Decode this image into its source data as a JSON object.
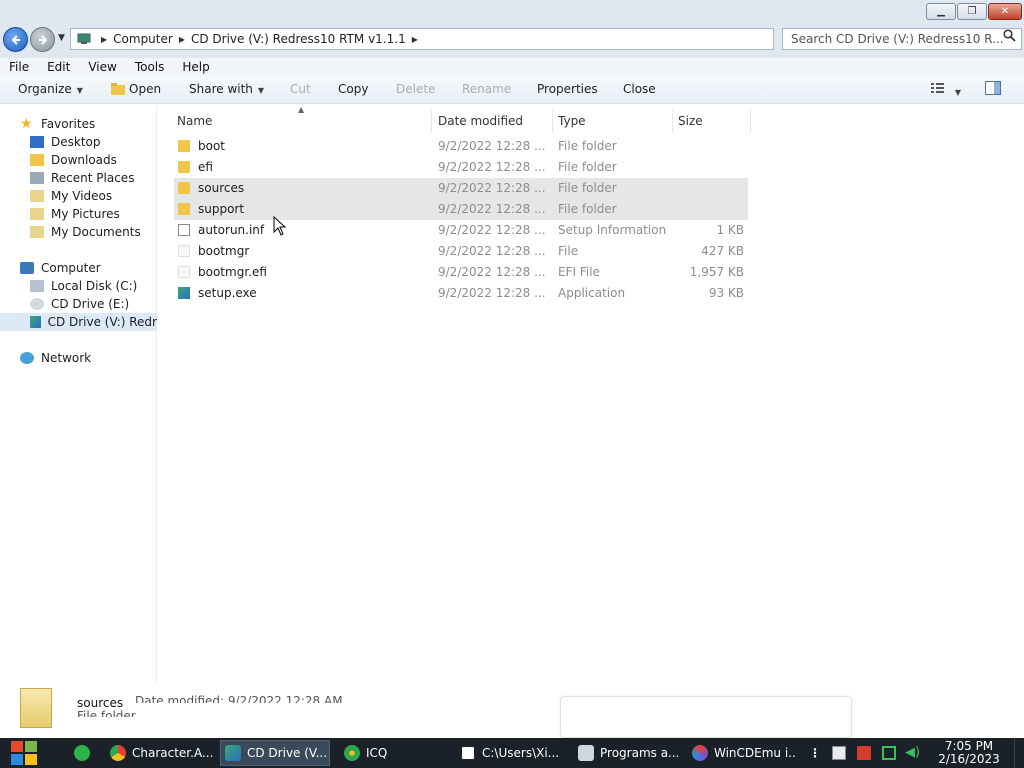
{
  "window": {
    "minimize_symbol": "▁",
    "maximize_symbol": "❐",
    "close_symbol": "✕"
  },
  "address": {
    "crumbs": [
      "Computer",
      "CD Drive (V:) Redress10 RTM v1.1.1"
    ],
    "search_placeholder": "Search CD Drive (V:) Redress10 R..."
  },
  "menu": [
    "File",
    "Edit",
    "View",
    "Tools",
    "Help"
  ],
  "commands": {
    "organize": "Organize",
    "open": "Open",
    "share_with": "Share with",
    "cut": "Cut",
    "copy": "Copy",
    "delete": "Delete",
    "rename": "Rename",
    "properties": "Properties",
    "close": "Close"
  },
  "sidebar": {
    "favorites": "Favorites",
    "favorites_items": [
      "Desktop",
      "Downloads",
      "Recent Places",
      "My Videos",
      "My Pictures",
      "My Documents"
    ],
    "computer": "Computer",
    "computer_items": [
      "Local Disk (C:)",
      "CD Drive (E:)",
      "CD Drive (V:) Redr"
    ],
    "network": "Network"
  },
  "columns": {
    "name": "Name",
    "date": "Date modified",
    "type": "Type",
    "size": "Size"
  },
  "files": [
    {
      "name": "boot",
      "date": "9/2/2022 12:28 ...",
      "type": "File folder",
      "size": "",
      "icon": "folder-icon",
      "selected": false
    },
    {
      "name": "efi",
      "date": "9/2/2022 12:28 ...",
      "type": "File folder",
      "size": "",
      "icon": "folder-icon",
      "selected": false
    },
    {
      "name": "sources",
      "date": "9/2/2022 12:28 ...",
      "type": "File folder",
      "size": "",
      "icon": "folder-icon",
      "selected": true
    },
    {
      "name": "support",
      "date": "9/2/2022 12:28 ...",
      "type": "File folder",
      "size": "",
      "icon": "folder-icon",
      "selected": true
    },
    {
      "name": "autorun.inf",
      "date": "9/2/2022 12:28 ...",
      "type": "Setup Information",
      "size": "1 KB",
      "icon": "setup-info-icon",
      "selected": false
    },
    {
      "name": "bootmgr",
      "date": "9/2/2022 12:28 ...",
      "type": "File",
      "size": "427 KB",
      "icon": "file-icon",
      "selected": false
    },
    {
      "name": "bootmgr.efi",
      "date": "9/2/2022 12:28 ...",
      "type": "EFI File",
      "size": "1,957 KB",
      "icon": "file-icon",
      "selected": false
    },
    {
      "name": "setup.exe",
      "date": "9/2/2022 12:28 ...",
      "type": "Application",
      "size": "93 KB",
      "icon": "application-icon",
      "selected": false
    }
  ],
  "details": {
    "name": "sources",
    "date_label": "Date modified: 9/2/2022 12:28 AM",
    "type": "File folder"
  },
  "taskbar": {
    "apps": [
      "Character.A...",
      "CD Drive (V...",
      "ICQ",
      "C:\\Users\\Xi...",
      "Programs a...",
      "WinCDEmu i..."
    ],
    "overflow": "⋮",
    "time": "7:05 PM",
    "date": "2/16/2023"
  },
  "colors": {
    "titlebar": "#dfe7f1",
    "selection": "#e6e6e6",
    "nav_selected": "#dce9f7",
    "taskbar": "#1a2129"
  }
}
